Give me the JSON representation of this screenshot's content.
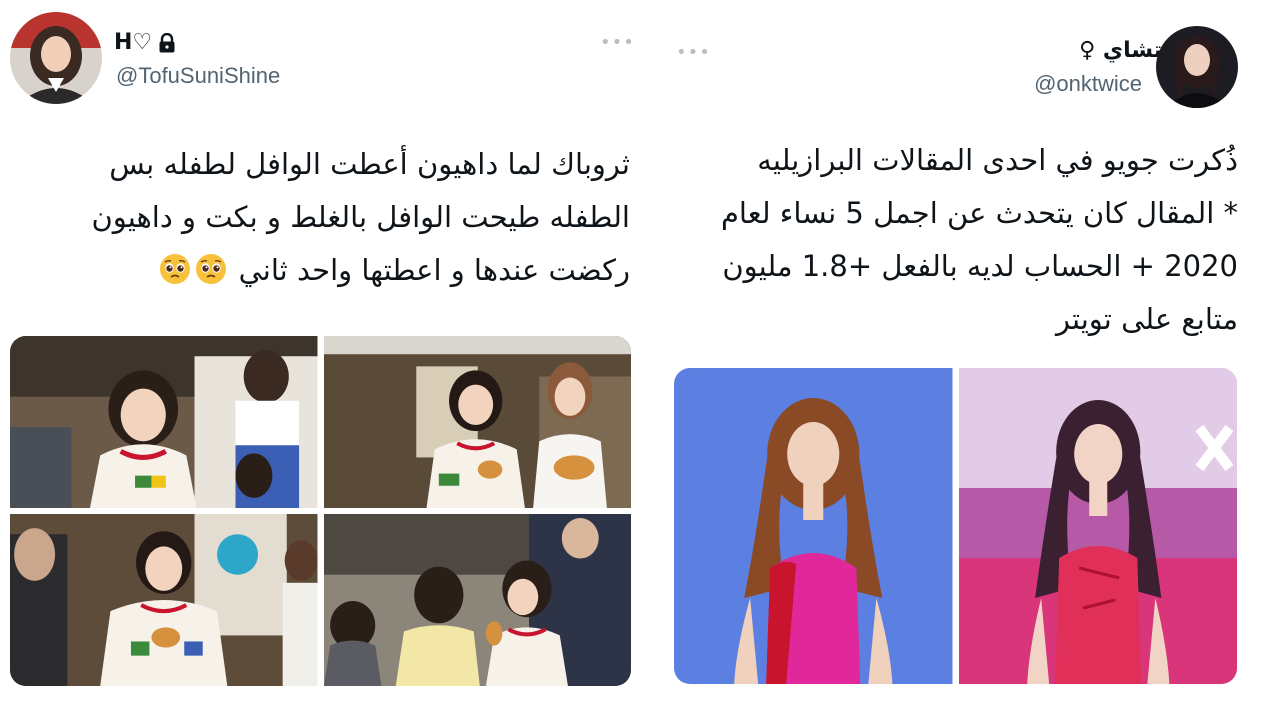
{
  "tweets": [
    {
      "display_name": "H♡",
      "handle": "@TofuSuniShine",
      "more_label": "•••",
      "locked": true,
      "lines": [
        "ثروباك لما داهيون أعطت الوافل لطفله بس",
        "الطفله طيحت الوافل بالغلط و بكت و داهيون",
        "ركضت عندها و اعطتها واحد ثاني"
      ],
      "emoji": [
        "pleading-face",
        "pleading-face"
      ],
      "media_count": 4
    },
    {
      "display_name": "تشاي ♀",
      "handle": "@onktwice",
      "more_label": "•••",
      "locked": false,
      "lines": [
        "ذُكرت جويو في احدى المقالات البرازيليه",
        "* المقال كان يتحدث عن اجمل 5 نساء لعام",
        "2020 + الحساب لديه بالفعل +1.8 مليون",
        "متابع على تويتر"
      ],
      "media_count": 2
    }
  ],
  "colors": {
    "handle": "#536471",
    "text": "#0f1419",
    "red": "#c8142d",
    "blue_backdrop": "#5a7fe0",
    "pink_stage": "#d9357a"
  }
}
